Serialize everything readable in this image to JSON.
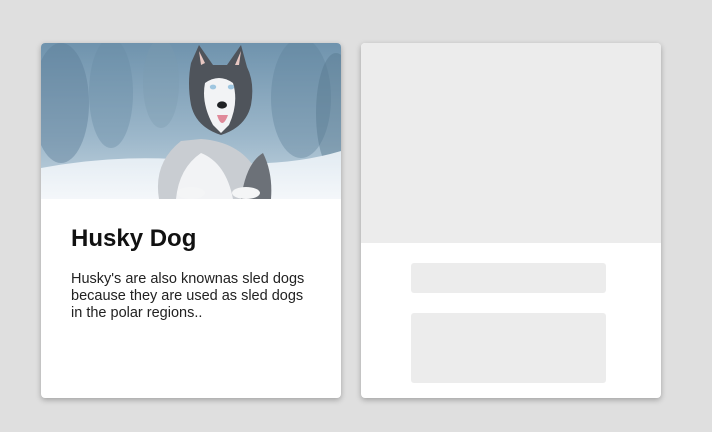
{
  "cards": [
    {
      "title": "Husky Dog",
      "text": "Husky's are also knownas sled dogs because they are used as sled dogs in the polar regions..",
      "image": "husky-dog-in-snow"
    },
    {
      "state": "loading-skeleton"
    }
  ],
  "colors": {
    "page_background": "#dfdfdf",
    "card_background": "#ffffff",
    "skeleton": "#ececec"
  }
}
